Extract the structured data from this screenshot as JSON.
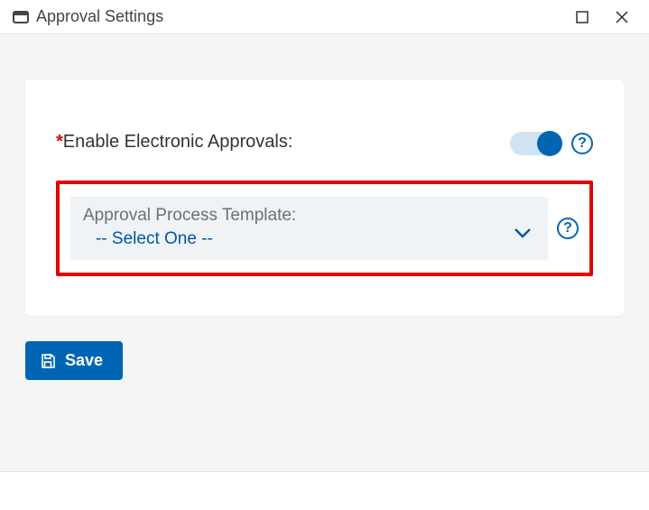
{
  "window": {
    "title": "Approval Settings"
  },
  "form": {
    "enable_label": "Enable Electronic Approvals:",
    "enable_value": true,
    "template": {
      "label": "Approval Process Template:",
      "selected": "-- Select One --"
    }
  },
  "footer": {
    "save_label": "Save"
  },
  "colors": {
    "accent": "#0066b3",
    "highlight": "#e60000",
    "required": "#d80808"
  }
}
